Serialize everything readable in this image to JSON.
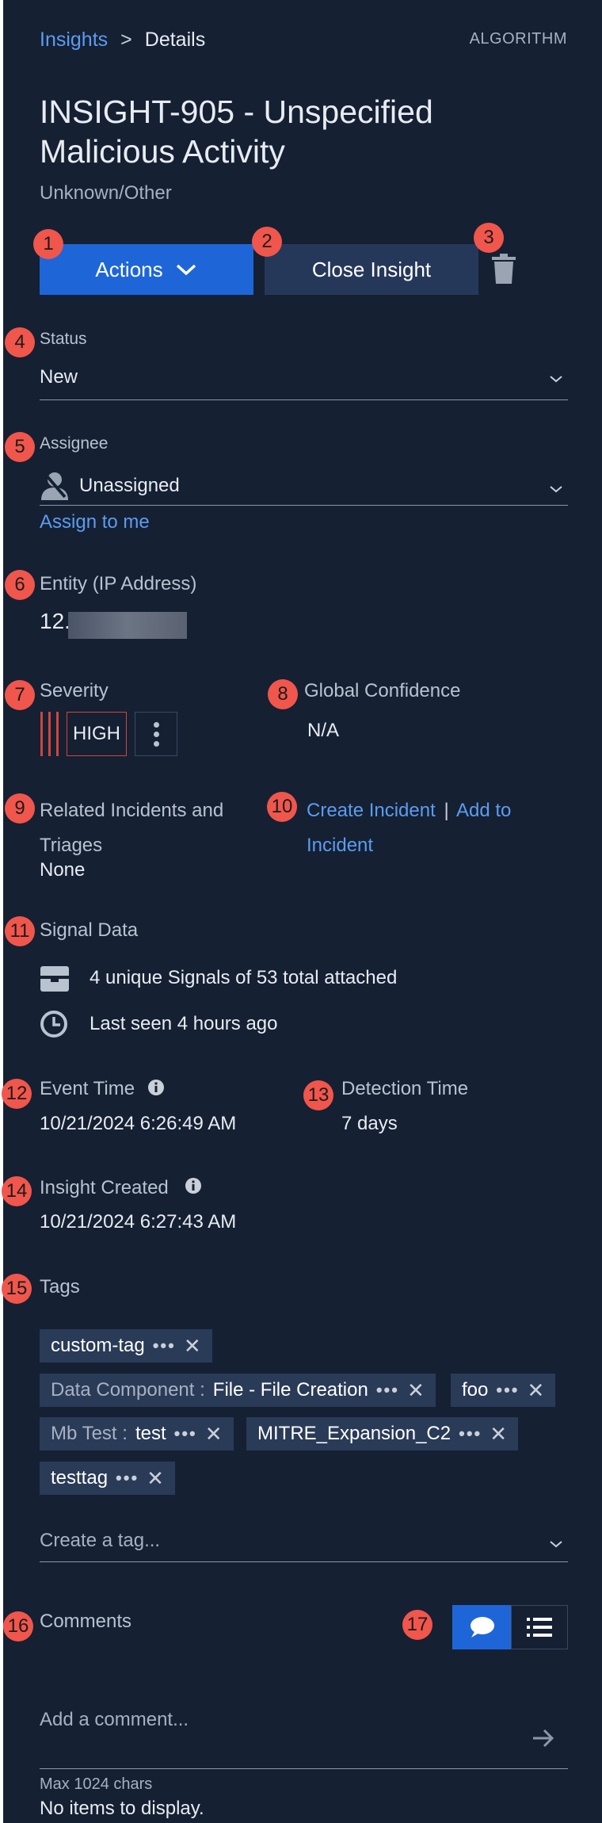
{
  "breadcrumb": {
    "root": "Insights",
    "separator": ">",
    "current": "Details"
  },
  "header_right": "ALGORITHM",
  "title": "INSIGHT-905 - Unspecified Malicious Activity",
  "subtitle": "Unknown/Other",
  "actions": {
    "actions_label": "Actions",
    "close_label": "Close Insight"
  },
  "callouts": [
    "1",
    "2",
    "3",
    "4",
    "5",
    "6",
    "7",
    "8",
    "9",
    "10",
    "11",
    "12",
    "13",
    "14",
    "15",
    "16",
    "17"
  ],
  "status": {
    "label": "Status",
    "value": "New"
  },
  "assignee": {
    "label": "Assignee",
    "value": "Unassigned",
    "assign_link": "Assign to me"
  },
  "entity": {
    "label": "Entity (IP Address)",
    "value": "12."
  },
  "severity": {
    "label": "Severity",
    "value": "HIGH"
  },
  "global_confidence": {
    "label": "Global Confidence",
    "value": "N/A"
  },
  "related": {
    "label_line1": "Related Incidents and",
    "label_line2": "Triages",
    "value": "None",
    "create_link": "Create Incident",
    "divider": "|",
    "add_link_line1": "Add to",
    "add_link_line2": "Incident"
  },
  "signal_data": {
    "label": "Signal Data",
    "signals_text": "4 unique Signals of 53 total attached",
    "last_seen_text": "Last seen 4 hours ago"
  },
  "event_time": {
    "label": "Event Time",
    "value": "10/21/2024 6:26:49 AM"
  },
  "detection_time": {
    "label": "Detection Time",
    "value": "7 days"
  },
  "insight_created": {
    "label": "Insight Created",
    "value": "10/21/2024 6:27:43 AM"
  },
  "tags": {
    "label": "Tags",
    "items": [
      {
        "key": "",
        "value": "custom-tag"
      },
      {
        "key": "Data Component :",
        "value": "File - File Creation"
      },
      {
        "key": "",
        "value": "foo"
      },
      {
        "key": "Mb Test :",
        "value": "test"
      },
      {
        "key": "",
        "value": "MITRE_Expansion_C2"
      },
      {
        "key": "",
        "value": "testtag"
      }
    ],
    "more_glyph": "•••",
    "remove_glyph": "✕",
    "placeholder": "Create a tag..."
  },
  "comments": {
    "label": "Comments",
    "placeholder": "Add a comment...",
    "max_chars": "Max 1024 chars",
    "empty_text": "No items to display."
  },
  "colors": {
    "background": "#152033",
    "primary": "#1e66d8",
    "link": "#5c9cf0",
    "callout": "#f0564c",
    "severity": "#d2443c"
  }
}
